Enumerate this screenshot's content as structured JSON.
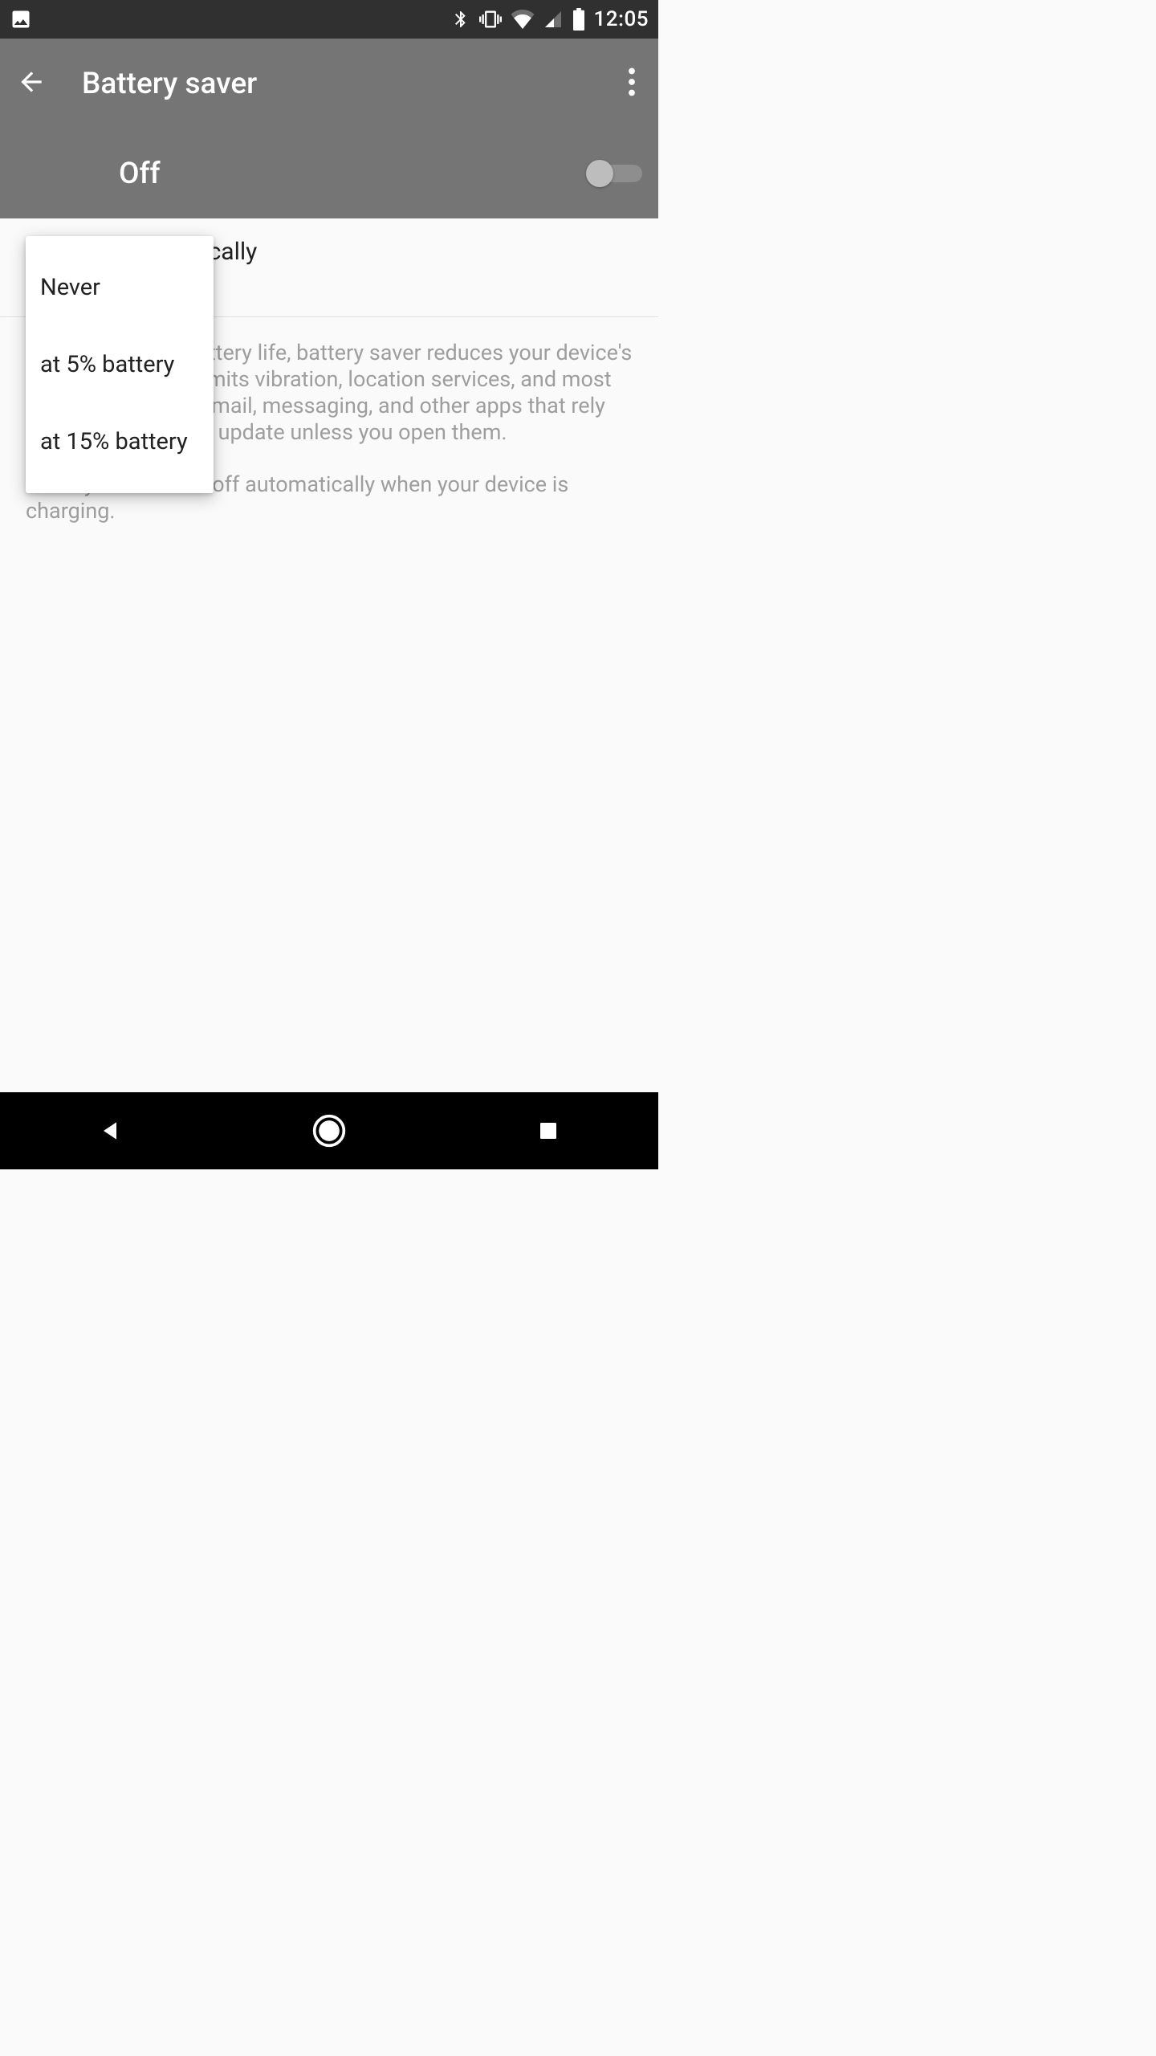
{
  "status": {
    "clock": "12:05"
  },
  "appbar": {
    "title": "Battery saver"
  },
  "toggle": {
    "label": "Off",
    "on": false
  },
  "pref": {
    "title": "Turn on automatically",
    "value": "Never"
  },
  "description": {
    "p1": "To help improve battery life, battery saver reduces your device's performance and limits vibration, location services, and most background data. Email, messaging, and other apps that rely on syncing may not update unless you open them.",
    "p2": "Battery saver turns off automatically when your device is charging."
  },
  "popup": {
    "options": [
      {
        "label": "Never"
      },
      {
        "label": "at 5% battery"
      },
      {
        "label": "at 15% battery"
      }
    ]
  }
}
